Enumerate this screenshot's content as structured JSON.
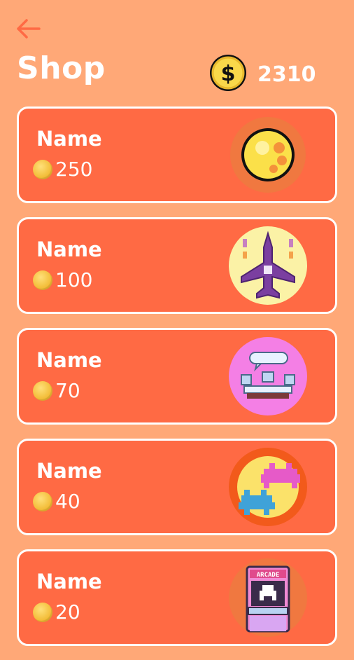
{
  "header": {
    "title": "Shop",
    "back_icon": "arrow-left-icon",
    "balance": {
      "icon": "dollar-coin-icon",
      "value": "2310"
    }
  },
  "items": [
    {
      "name": "Name",
      "price": "250",
      "icon": "gold-coin-icon"
    },
    {
      "name": "Name",
      "price": "100",
      "icon": "fighter-jet-icon"
    },
    {
      "name": "Name",
      "price": "70",
      "icon": "tables-icon"
    },
    {
      "name": "Name",
      "price": "40",
      "icon": "space-invaders-icon"
    },
    {
      "name": "Name",
      "price": "20",
      "icon": "arcade-machine-icon"
    }
  ],
  "colors": {
    "background": "#FFA877",
    "card": "#FF6A44",
    "card_border": "#FFFFFF",
    "text": "#FFFFFF",
    "coin": "#F3BE3A"
  }
}
